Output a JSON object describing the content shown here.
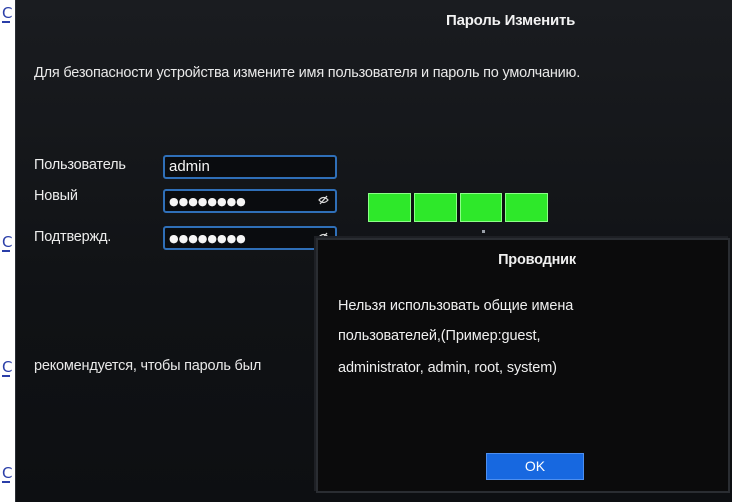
{
  "dialog": {
    "title": "Пароль Изменить",
    "notice": "Для безопасности устройства измените имя пользователя и пароль по умолчанию."
  },
  "form": {
    "user_label": "Пользователь",
    "user_value": "admin",
    "new_label": "Новый",
    "new_value": "●●●●●●●●",
    "confirm_label": "Подтвержд.",
    "confirm_value": "●●●●●●●●"
  },
  "strength": {
    "filled_segments": 4,
    "total_segments": 4,
    "color": "#2ee82a"
  },
  "hint": "рекомендуется, чтобы пароль был",
  "modal": {
    "title": "Проводник",
    "lines": [
      "Нельзя использовать общие имена",
      "пользователей,(Пример:guest,",
      "administrator, admin, root, system)"
    ],
    "ok_label": "OK"
  },
  "edge_glyphs": [
    "C",
    "C",
    "C",
    "C"
  ],
  "colors": {
    "field_border": "#2f6fb8",
    "ok_button": "#1768e0",
    "background": "#101215"
  }
}
